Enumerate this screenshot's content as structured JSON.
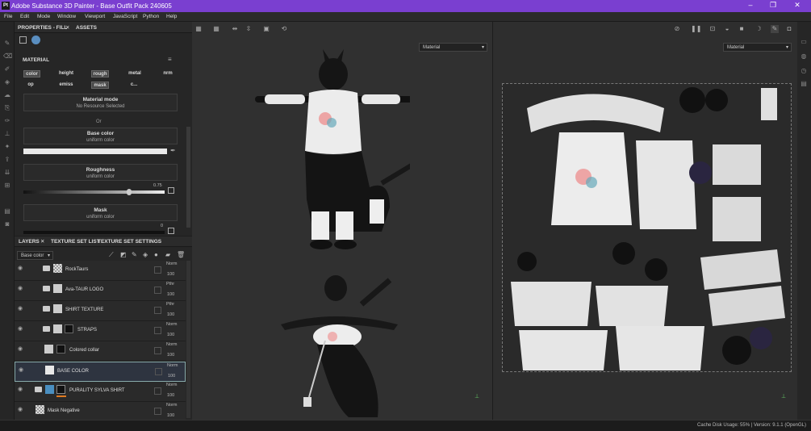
{
  "titlebar": {
    "title": "Adobe Substance 3D Painter - Base Outfit Pack 240605",
    "logo": "Pt"
  },
  "menu": [
    "File",
    "Edit",
    "Mode",
    "Window",
    "Viewport",
    "JavaScript",
    "Python",
    "Help"
  ],
  "properties": {
    "tab_label": "PROPERTIES - FILL",
    "assets_label": "ASSETS",
    "material_label": "MATERIAL",
    "channels": [
      "color",
      "height",
      "rough",
      "metal",
      "nrm",
      "op",
      "emiss",
      "mask",
      "c..."
    ],
    "material_mode": {
      "title": "Material mode",
      "value": "No Resource Selected"
    },
    "or_label": "Or",
    "base_color": {
      "title": "Base color",
      "value": "uniform color"
    },
    "roughness": {
      "title": "Roughness",
      "value": "uniform color",
      "number": "0.75",
      "fraction": 0.75
    },
    "mask": {
      "title": "Mask",
      "value": "uniform color",
      "number": "0"
    }
  },
  "layers_panel": {
    "tabs": [
      "LAYERS",
      "TEXTURE SET LIST",
      "TEXTURE SET SETTINGS"
    ],
    "channel_select": "Base color",
    "rows": [
      {
        "name": "RockTaurs",
        "blend": "Norm",
        "opacity": "100"
      },
      {
        "name": "Ava-TAUR LOGO",
        "blend": "Pthr",
        "opacity": "100"
      },
      {
        "name": "SHIRT TEXTURE",
        "blend": "Pthr",
        "opacity": "100"
      },
      {
        "name": "STRAPS",
        "blend": "Norm",
        "opacity": "100"
      },
      {
        "name": "Colored collar",
        "blend": "Norm",
        "opacity": "100"
      },
      {
        "name": "BASE COLOR",
        "blend": "Norm",
        "opacity": "100"
      },
      {
        "name": "PURALITY SYLVA SHIRT",
        "blend": "Norm",
        "opacity": "100"
      },
      {
        "name": "Mask Negative",
        "blend": "Norm",
        "opacity": "100"
      }
    ]
  },
  "viewport3d": {
    "dropdown": "Material"
  },
  "viewport2d": {
    "dropdown": "Material"
  },
  "status": {
    "text": "Cache Disk Usage:   55% | Version: 9.1.1 (OpenGL)"
  },
  "colors": {
    "accent": "#7a3fd0",
    "panel": "#262626",
    "viewport": "#303030"
  }
}
